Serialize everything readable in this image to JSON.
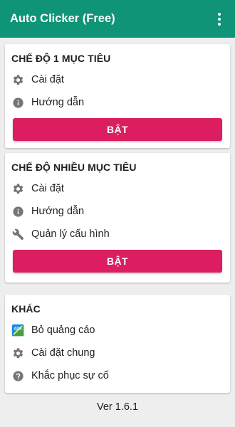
{
  "appbar": {
    "title": "Auto Clicker (Free)",
    "menu_icon": "more-vert-icon",
    "color": "#0f9477"
  },
  "single_target": {
    "title": "CHẾ ĐỘ 1 MỤC TIÊU",
    "settings_label": "Cài đặt",
    "guide_label": "Hướng dẫn",
    "enable_label": "BẬT"
  },
  "multi_target": {
    "title": "CHẾ ĐỘ NHIỀU MỤC TIÊU",
    "settings_label": "Cài đặt",
    "guide_label": "Hướng dẫn",
    "config_label": "Quản lý cấu hình",
    "enable_label": "BẬT"
  },
  "other": {
    "title": "KHÁC",
    "remove_ads_label": "Bỏ quảng cáo",
    "general_settings_label": "Cài đặt chung",
    "troubleshoot_label": "Khắc phục sự cố"
  },
  "version": "Ver 1.6.1",
  "colors": {
    "accent_button": "#dc1e60",
    "icon_gray": "#757575",
    "background": "#eeeeee"
  }
}
